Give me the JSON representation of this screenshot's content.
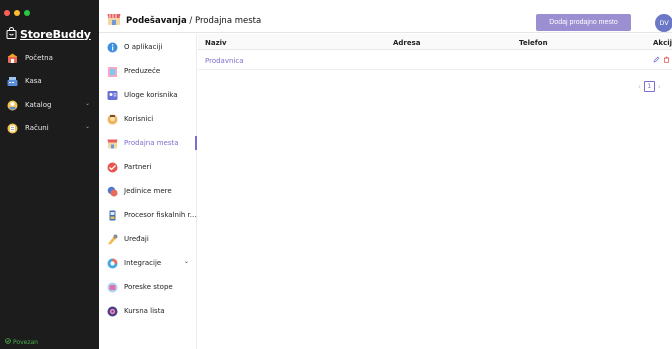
{
  "app": {
    "name": "StoreBuddy"
  },
  "colors": {
    "accent": "#7a6fcf",
    "button": "#9b8fd1",
    "sidebar_bg": "#1c1c1c",
    "status_green": "#4caf50"
  },
  "sidebar": {
    "items": [
      {
        "label": "Početna",
        "icon": "home-icon"
      },
      {
        "label": "Kasa",
        "icon": "register-icon"
      },
      {
        "label": "Katalog",
        "icon": "catalog-icon",
        "expandable": true
      },
      {
        "label": "Računi",
        "icon": "receipt-icon",
        "expandable": true
      }
    ],
    "status": "Povezan"
  },
  "header": {
    "section": "Podešavanja",
    "separator": " / ",
    "page": "Prodajna mesta",
    "add_button": "Dodaj prodajno mesto",
    "avatar_initials": "DV"
  },
  "settings_nav": {
    "items": [
      {
        "label": "O aplikaciji",
        "icon": "info-icon"
      },
      {
        "label": "Preduzeće",
        "icon": "company-icon"
      },
      {
        "label": "Uloge korisnika",
        "icon": "roles-icon"
      },
      {
        "label": "Korisnici",
        "icon": "users-icon"
      },
      {
        "label": "Prodajna mesta",
        "icon": "store-icon",
        "active": true
      },
      {
        "label": "Partneri",
        "icon": "partners-icon"
      },
      {
        "label": "Jedinice mere",
        "icon": "units-icon"
      },
      {
        "label": "Procesor fiskalnih r...",
        "icon": "fiscal-processor-icon"
      },
      {
        "label": "Uređaji",
        "icon": "devices-icon"
      },
      {
        "label": "Integracije",
        "icon": "integrations-icon",
        "expandable": true
      },
      {
        "label": "Poreske stope",
        "icon": "tax-icon"
      },
      {
        "label": "Kursna lista",
        "icon": "exchange-icon"
      }
    ]
  },
  "table": {
    "columns": [
      "Naziv",
      "Adresa",
      "Telefon",
      "Akcije"
    ],
    "rows": [
      {
        "naziv": "Prodavnica",
        "adresa": "",
        "telefon": ""
      }
    ]
  },
  "pagination": {
    "prev": "‹",
    "page": "1",
    "next": "›"
  }
}
